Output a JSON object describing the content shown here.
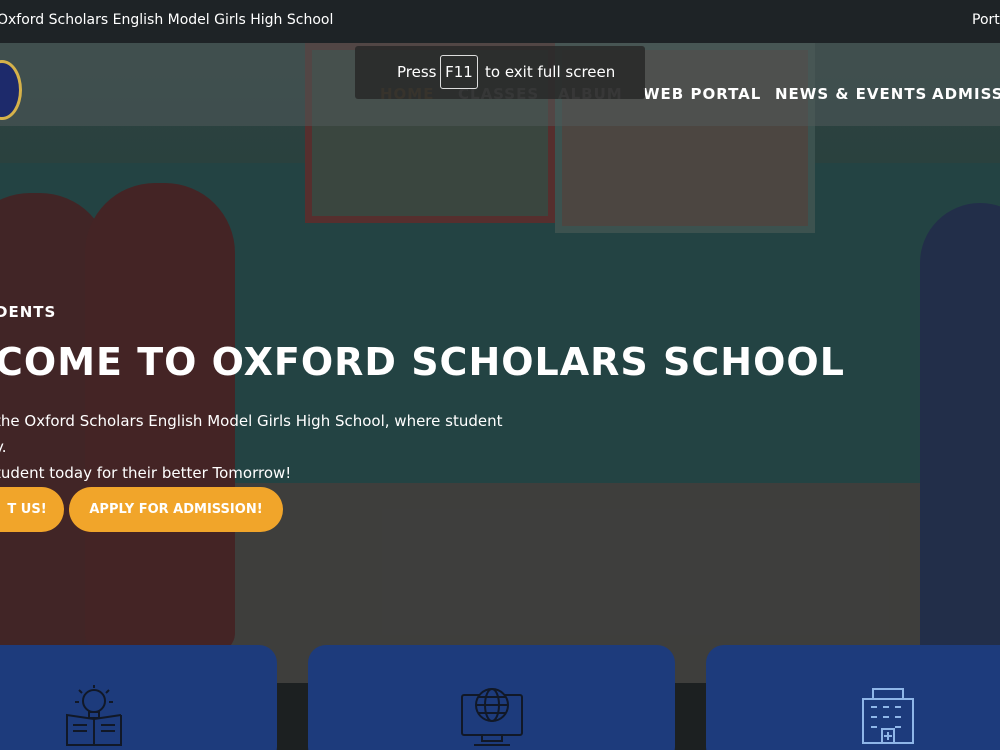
{
  "topbar": {
    "school_name": "Oxford Scholars English Model Girls High School",
    "right_link": "Port"
  },
  "fullscreen_toast": {
    "press": "Press",
    "key": "F11",
    "message": "to exit full screen"
  },
  "nav": {
    "items": [
      {
        "label": "HOME"
      },
      {
        "label": "CLASSES"
      },
      {
        "label": "ALBUM"
      },
      {
        "label": "WEB PORTAL"
      },
      {
        "label": "NEWS & EVENTS"
      },
      {
        "label": "ADMISSI"
      }
    ]
  },
  "hero": {
    "eyebrow": "DENTS",
    "headline": "COME TO OXFORD SCHOLARS SCHOOL",
    "paragraph_line1": "the Oxford Scholars English Model Girls High School, where student",
    "paragraph_line2": "y.",
    "paragraph_line3": "tudent today for their better Tomorrow!",
    "contact_button": "T US!",
    "apply_button": "APPLY FOR ADMISSION!"
  },
  "cards": [
    {
      "icon": "idea-book-icon"
    },
    {
      "icon": "globe-computer-icon"
    },
    {
      "icon": "hospital-building-icon"
    }
  ],
  "colors": {
    "accent": "#f1a52a",
    "card_blue": "#1d3b7c",
    "topbar": "#1e2326"
  }
}
